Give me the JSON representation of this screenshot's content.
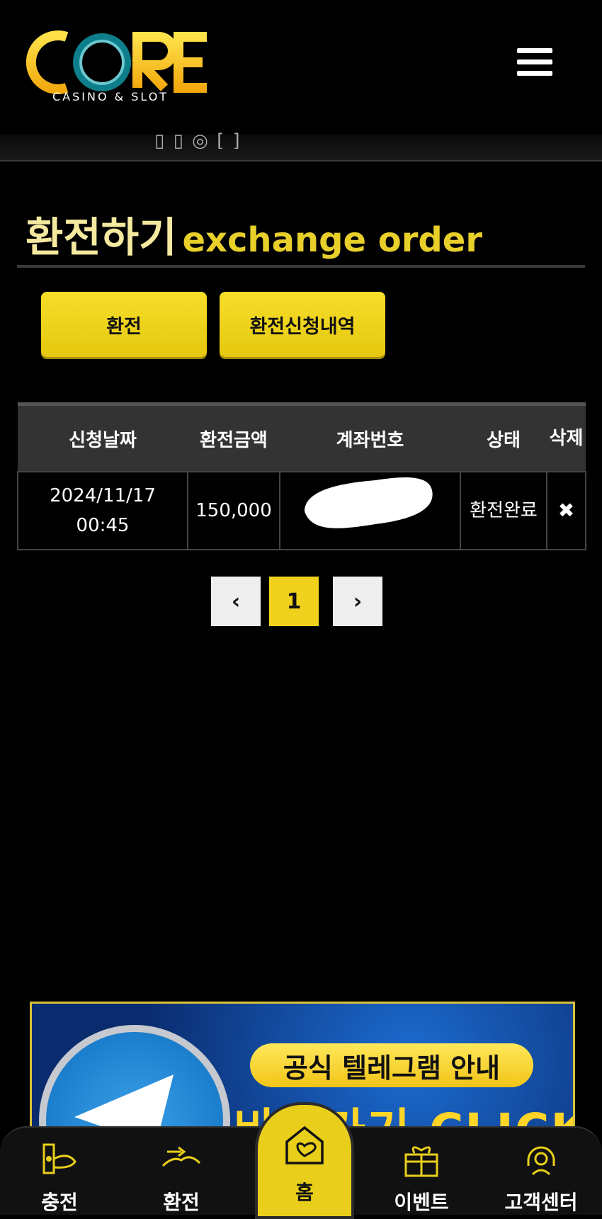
{
  "header": {
    "logo_text": "CORE",
    "logo_sub": "CASINO & SLOT",
    "subbar_text": "▯ ▯ ◎ [ ]"
  },
  "page": {
    "title_ko": "환전하기",
    "title_en": "exchange order"
  },
  "tabs": [
    {
      "label": "환전"
    },
    {
      "label": "환전신청내역"
    }
  ],
  "table": {
    "headers": [
      "신청날짜",
      "환전금액",
      "계좌번호",
      "상태",
      "삭제"
    ],
    "rows": [
      {
        "date": "2024/11/17",
        "time": "00:45",
        "amount": "150,000",
        "account": "",
        "status": "환전완료",
        "delete_icon": "✖"
      }
    ]
  },
  "pagination": {
    "prev": "‹",
    "current": "1",
    "next": "›"
  },
  "banner": {
    "pill_text": "공식 텔레그램 안내",
    "big_text": "바로가기 CLICK"
  },
  "bottom_nav": [
    {
      "label": "충전",
      "icon": "deposit-icon"
    },
    {
      "label": "환전",
      "icon": "withdraw-icon"
    },
    {
      "label": "홈",
      "icon": "home-heart-icon"
    },
    {
      "label": "이벤트",
      "icon": "gift-icon"
    },
    {
      "label": "고객센터",
      "icon": "headset-icon"
    }
  ],
  "colors": {
    "accent": "#f0d21e",
    "background": "#000000",
    "header_row": "#333333"
  }
}
